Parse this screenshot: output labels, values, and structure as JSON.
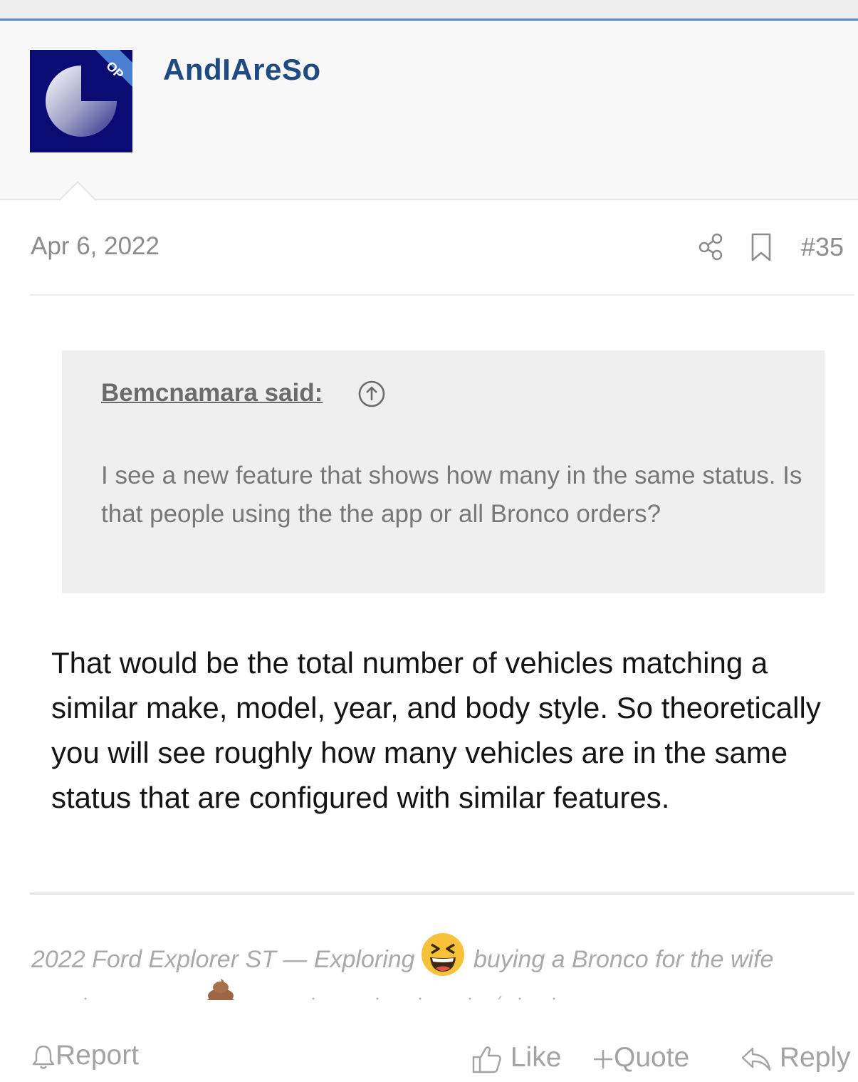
{
  "colors": {
    "accent_line": "#5b87c5",
    "username": "#1f4b82",
    "avatar_bg": "#0a0c73",
    "op_ribbon": "#4a7fd1",
    "meta_text": "#8d8d8d",
    "quote_bg": "#efefef"
  },
  "author": {
    "username": "AndIAreSo",
    "badge": "OP"
  },
  "post": {
    "date": "Apr 6, 2022",
    "number": "#35",
    "share_icon": "share-icon",
    "bookmark_icon": "bookmark-icon"
  },
  "quote": {
    "author_label": "Bemcnamara said:",
    "jump_icon": "arrow-up-circle-icon",
    "text": "I see a new feature that shows how many in the same status. Is that people using the the app or all Bronco orders?"
  },
  "body": {
    "text": "That would be the total number of vehicles matching a similar make, model, year, and body style. So theoretically you will see roughly how many vehicles are in the same status that are configured with similar features."
  },
  "signature": {
    "text_before_emoji": "2022 Ford Explorer ST — Exploring",
    "text_after_emoji": "buying a Bronco for the wife",
    "emoji_1": "laughing-emoji",
    "emoji_2": "poo-emoji"
  },
  "actions": {
    "report": "Report",
    "like": "Like",
    "quote": "Quote",
    "reply": "Reply"
  }
}
